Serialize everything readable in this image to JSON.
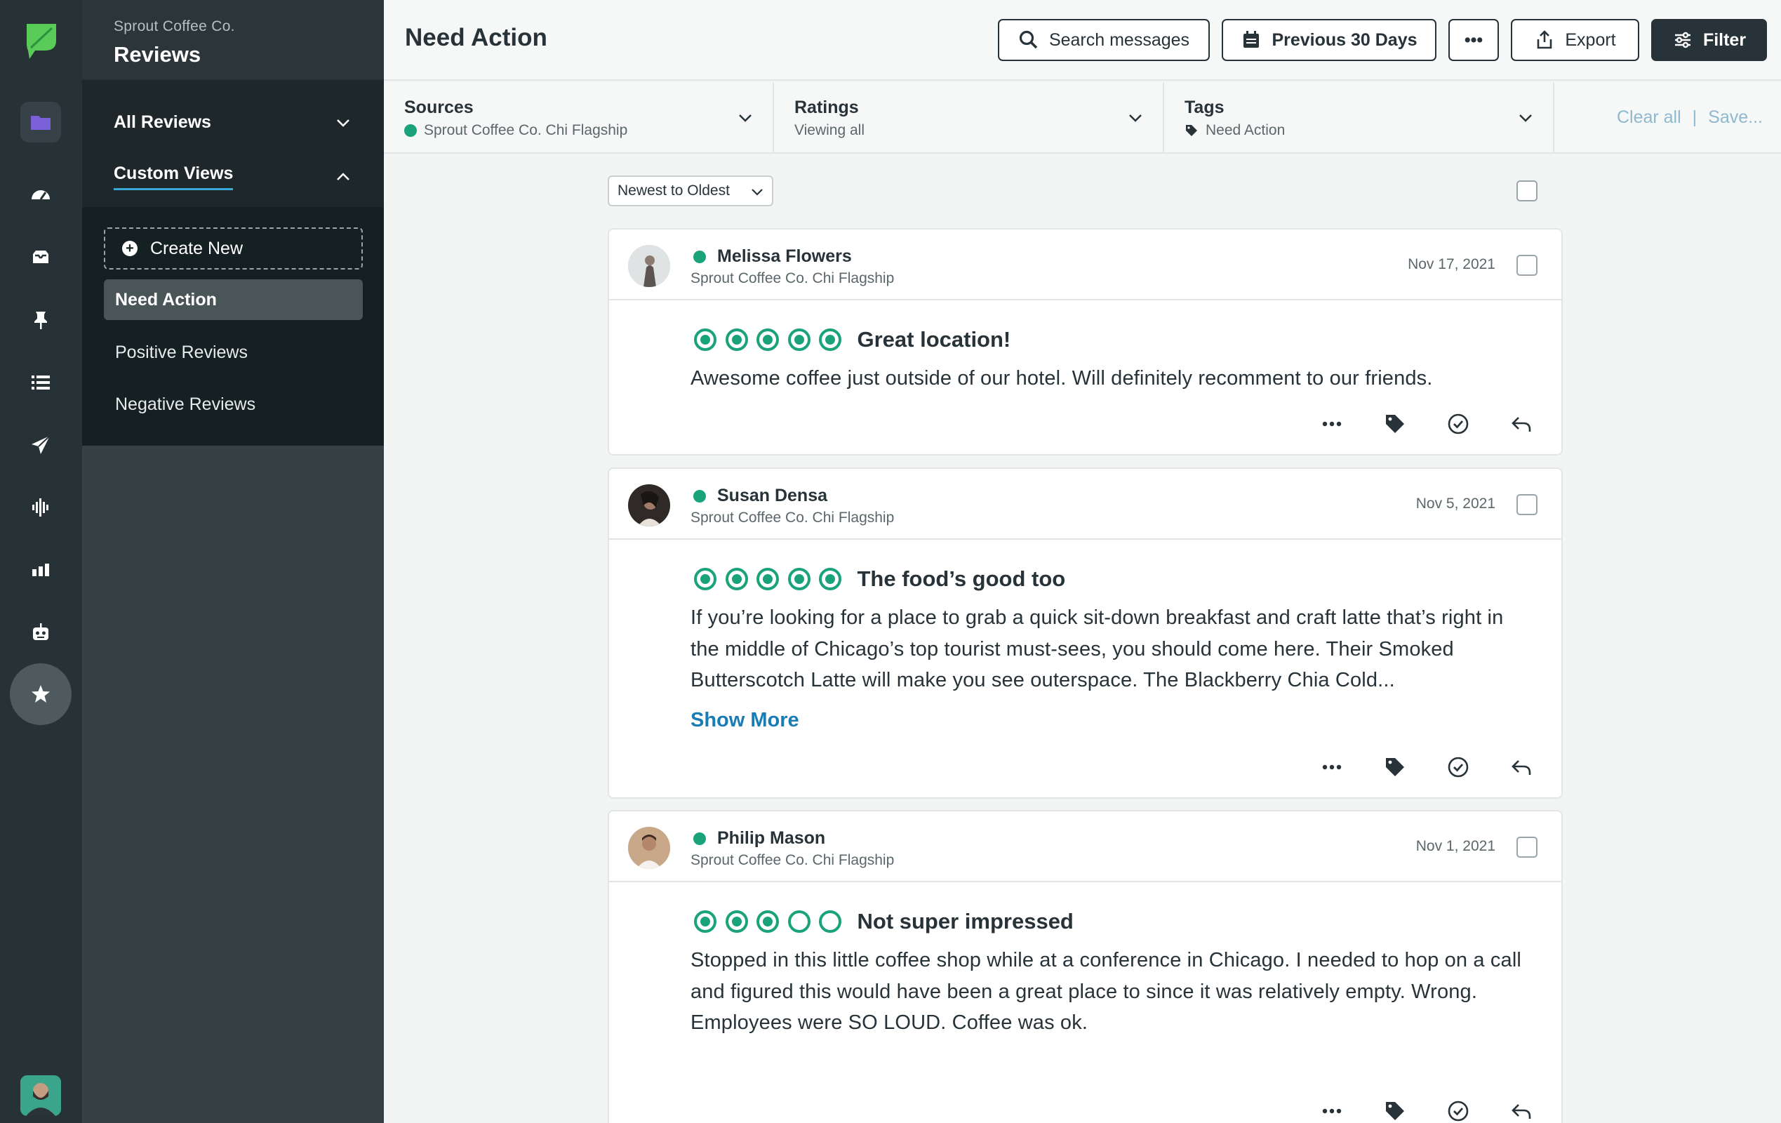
{
  "app": {
    "company": "Sprout Coffee Co.",
    "section": "Reviews",
    "page_title": "Need Action"
  },
  "rail": {
    "items": [
      {
        "icon": "folder-icon"
      },
      {
        "icon": "dashboard-icon"
      },
      {
        "icon": "inbox-icon"
      },
      {
        "icon": "pin-icon"
      },
      {
        "icon": "list-icon"
      },
      {
        "icon": "send-icon"
      },
      {
        "icon": "listening-icon"
      },
      {
        "icon": "reports-icon"
      },
      {
        "icon": "bot-icon"
      },
      {
        "icon": "star-review-icon"
      }
    ]
  },
  "sidebar": {
    "all_reviews": "All Reviews",
    "custom_views": "Custom Views",
    "create_new": "Create New",
    "items": [
      {
        "label": "Need Action"
      },
      {
        "label": "Positive Reviews"
      },
      {
        "label": "Negative Reviews"
      }
    ]
  },
  "toolbar": {
    "search": "Search messages",
    "date_range": "Previous 30 Days",
    "more": "•••",
    "export": "Export",
    "filter": "Filter"
  },
  "filters": {
    "sources": {
      "title": "Sources",
      "value": "Sprout Coffee Co. Chi Flagship"
    },
    "ratings": {
      "title": "Ratings",
      "value": "Viewing all"
    },
    "tags": {
      "title": "Tags",
      "value": "Need Action"
    },
    "clear_all": "Clear all",
    "separator": "|",
    "save": "Save..."
  },
  "sort": {
    "selected": "Newest to Oldest"
  },
  "colors": {
    "accent_green": "#1aa37a",
    "link_blue": "#1b7cb3",
    "rail_bg": "#273236",
    "panel_dark": "#152023"
  },
  "reviews": [
    {
      "author": "Melissa Flowers",
      "source": "Sprout Coffee Co. Chi Flagship",
      "date": "Nov 17, 2021",
      "rating": 5,
      "title": "Great location!",
      "body": "Awesome coffee just outside of our hotel. Will definitely recomment to our friends.",
      "show_more": ""
    },
    {
      "author": "Susan Densa",
      "source": "Sprout Coffee Co. Chi Flagship",
      "date": "Nov 5, 2021",
      "rating": 5,
      "title": "The food’s good too",
      "body": "If you’re looking for a place to grab a quick sit-down breakfast and craft latte that’s right in the middle of Chicago’s top tourist must-sees, you should come here. Their Smoked Butterscotch Latte will make you see outerspace. The Blackberry Chia Cold...",
      "show_more": "Show More"
    },
    {
      "author": "Philip Mason",
      "source": "Sprout Coffee Co. Chi Flagship",
      "date": "Nov 1, 2021",
      "rating": 3,
      "title": "Not super impressed",
      "body": "Stopped in this little coffee shop while at a conference in Chicago. I needed to hop on a call and figured this would have been a great place to since it was relatively empty. Wrong. Employees were SO LOUD. Coffee was ok.",
      "show_more": ""
    }
  ]
}
